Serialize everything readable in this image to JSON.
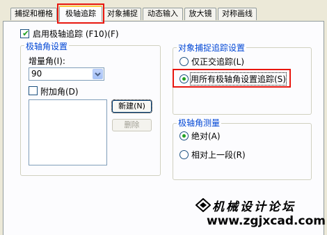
{
  "tabs": [
    {
      "label": "捕捉和栅格"
    },
    {
      "label": "极轴追踪"
    },
    {
      "label": "对象捕捉"
    },
    {
      "label": "动态输入"
    },
    {
      "label": "放大镜"
    },
    {
      "label": "对称画线"
    }
  ],
  "active_tab": "极轴追踪",
  "enable_polar": {
    "label": "启用极轴追踪 (F10)(F)",
    "checked": true
  },
  "polar_angle_settings": {
    "legend": "极轴角设置",
    "increment_label": "增量角(I):",
    "increment_value": "90",
    "additional_label": "附加角(D)",
    "additional_checked": false,
    "new_button": "新建(N)",
    "delete_button": "删除"
  },
  "object_snap_tracking": {
    "legend": "对象捕捉追踪设置",
    "options": [
      "仅正交追踪(L)",
      "用所有极轴角设置追踪(S)"
    ],
    "selected": 1
  },
  "polar_measurement": {
    "legend": "极轴角测量",
    "options": [
      "绝对(A)",
      "相对上一段(R)"
    ],
    "selected": 0
  },
  "watermark": {
    "name": "机械设计论坛",
    "url": "www.zgjxcad.com"
  },
  "colors": {
    "highlight": "#e8160e",
    "group_title": "#0046d5",
    "check_mark": "#21a121"
  }
}
